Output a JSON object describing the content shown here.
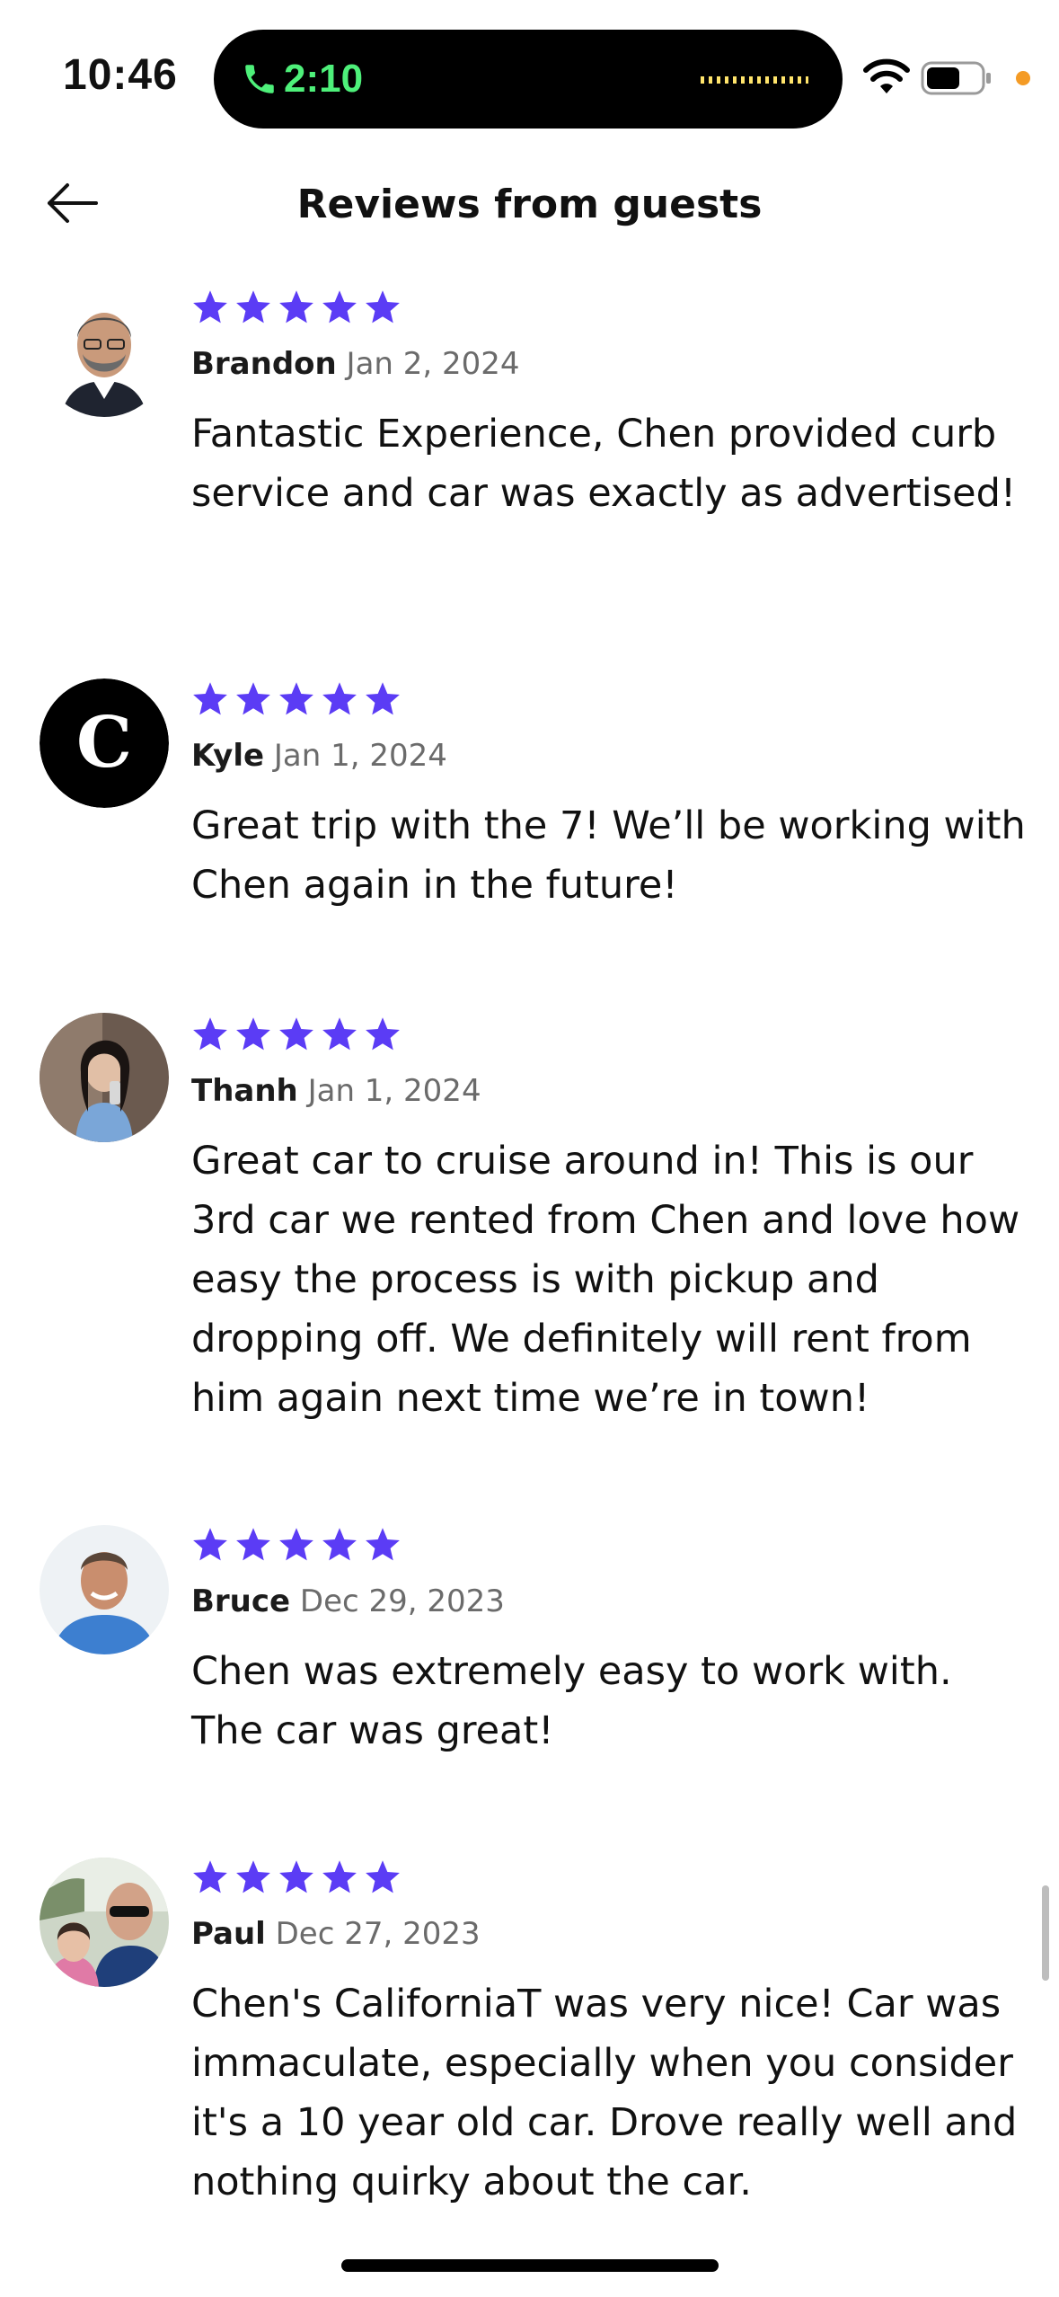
{
  "status_bar": {
    "time": "10:46",
    "call_time": "2:10",
    "accent_call_color": "#4ef07a"
  },
  "header": {
    "title": "Reviews from guests",
    "back_icon": "arrow-left-icon"
  },
  "colors": {
    "star": "#5b3cf5",
    "text": "#111111",
    "muted": "#6b6b6b"
  },
  "reviews": [
    {
      "name": "Brandon",
      "date": "Jan 2, 2024",
      "rating": 5,
      "text": "Fantastic Experience, Chen provided curb service and car was exactly as advertised!"
    },
    {
      "name": "Kyle",
      "date": "Jan 1, 2024",
      "rating": 5,
      "avatar_letter": "C",
      "text": "Great trip with the 7!  We’ll be working with Chen again in the future!"
    },
    {
      "name": "Thanh",
      "date": "Jan 1, 2024",
      "rating": 5,
      "text": "Great car to cruise around in! This is our 3rd car we rented from Chen and love how easy the process is with pickup and dropping off. We definitely will rent from him again next time we’re in town!"
    },
    {
      "name": "Bruce",
      "date": "Dec 29, 2023",
      "rating": 5,
      "text": "Chen was extremely easy to work with. The car was great!"
    },
    {
      "name": "Paul",
      "date": "Dec 27, 2023",
      "rating": 5,
      "text": "Chen's CaliforniaT was very nice! Car was immaculate, especially when you consider it's a 10 year old car.  Drove really well and nothing quirky about the car."
    }
  ]
}
